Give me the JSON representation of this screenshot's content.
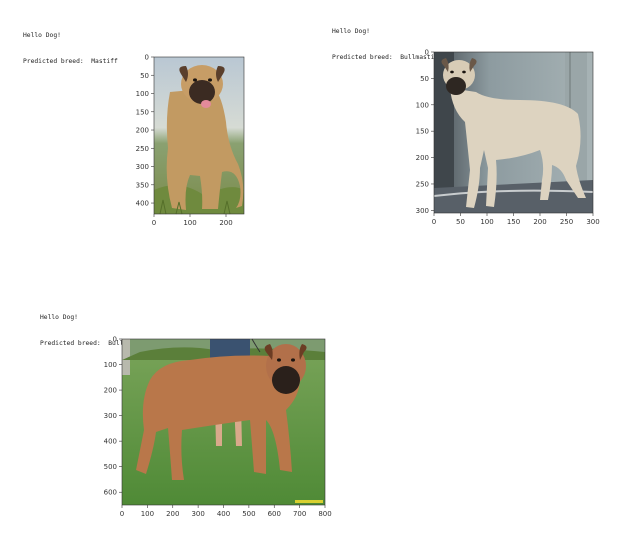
{
  "outputs": [
    {
      "greeting": "Hello Dog!",
      "prediction_label": "Predicted breed:",
      "breed": "Mastiff",
      "chart_data": {
        "type": "image",
        "xlim": [
          0,
          250
        ],
        "ylim": [
          430,
          0
        ],
        "x_ticks": [
          0,
          100,
          200
        ],
        "y_ticks": [
          0,
          50,
          100,
          150,
          200,
          250,
          300,
          350,
          400
        ]
      }
    },
    {
      "greeting": "Hello Dog!",
      "prediction_label": "Predicted breed:",
      "breed": "Bullmastiff",
      "chart_data": {
        "type": "image",
        "xlim": [
          0,
          300
        ],
        "ylim": [
          305,
          0
        ],
        "x_ticks": [
          0,
          50,
          100,
          150,
          200,
          250,
          300
        ],
        "y_ticks": [
          0,
          50,
          100,
          150,
          200,
          250,
          300
        ]
      }
    },
    {
      "greeting": "Hello Dog!",
      "prediction_label": "Predicted breed:",
      "breed": "Bullmastiff",
      "chart_data": {
        "type": "image",
        "xlim": [
          0,
          800
        ],
        "ylim": [
          650,
          0
        ],
        "x_ticks": [
          0,
          100,
          200,
          300,
          400,
          500,
          600,
          700,
          800
        ],
        "y_ticks": [
          0,
          100,
          200,
          300,
          400,
          500,
          600
        ]
      }
    }
  ]
}
